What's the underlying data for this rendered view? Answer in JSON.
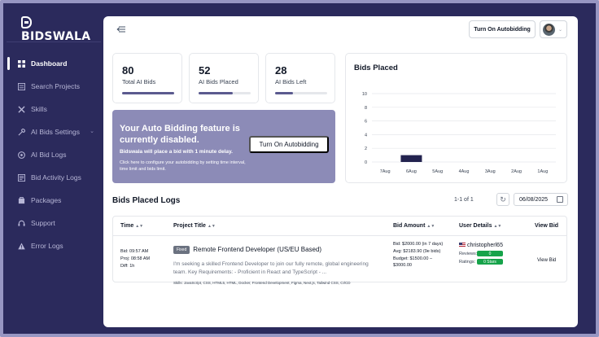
{
  "brand": {
    "name": "BIDSWALA"
  },
  "sidebar": {
    "items": [
      {
        "label": "Dashboard",
        "icon": "dashboard-icon"
      },
      {
        "label": "Search Projects",
        "icon": "search-projects-icon"
      },
      {
        "label": "Skills",
        "icon": "skills-icon"
      },
      {
        "label": "AI Bids Settings",
        "icon": "settings-icon"
      },
      {
        "label": "AI Bid Logs",
        "icon": "bid-logs-icon"
      },
      {
        "label": "Bid Activity Logs",
        "icon": "activity-logs-icon"
      },
      {
        "label": "Packages",
        "icon": "packages-icon"
      },
      {
        "label": "Support",
        "icon": "support-icon"
      },
      {
        "label": "Error Logs",
        "icon": "error-logs-icon"
      }
    ]
  },
  "header": {
    "autobid_button": "Turn On Autobidding"
  },
  "stats": [
    {
      "value": "80",
      "label": "Total AI Bids",
      "progress": 1.0
    },
    {
      "value": "52",
      "label": "AI Bids Placed",
      "progress": 0.65
    },
    {
      "value": "28",
      "label": "AI Bids Left",
      "progress": 0.35
    }
  ],
  "promo": {
    "title": "Your Auto Bidding feature is currently disabled.",
    "subtitle": "Bidswala will place a bid with 1 minute delay.",
    "help": "Click here to configure your autobidding by setting time interval, time limit and bids limit.",
    "button": "Turn On Autobidding"
  },
  "chart_data": {
    "type": "bar",
    "title": "Bids Placed",
    "categories": [
      "7Aug",
      "6Aug",
      "5Aug",
      "4Aug",
      "3Aug",
      "2Aug",
      "1Aug"
    ],
    "values": [
      0,
      1,
      0,
      0,
      0,
      0,
      0
    ],
    "ylim": [
      0,
      10
    ],
    "yticks": [
      0,
      2,
      4,
      6,
      8,
      10
    ],
    "grid": true,
    "colors": {
      "bar": "#23234f",
      "grid": "#e5e7eb"
    }
  },
  "logs": {
    "title": "Bids Placed Logs",
    "pagination": "1-1 of 1",
    "date": "06/08/2025",
    "columns": [
      "Time",
      "Project Title",
      "Bid Amount",
      "User Details",
      "View Bid"
    ],
    "rows": [
      {
        "time": [
          "Bid: 09:57 AM",
          "Proj: 08:58 AM",
          "Diff: 1h"
        ],
        "badge": "Fixed",
        "title": "Remote Frontend Developer (US/EU Based)",
        "description": "I'm seeking a skilled Frontend Developer to join our fully remote, global engineering team. Key Requirements: - Proficient in React and TypeScript - ...",
        "skills": "Skills: JavaScript, CSS, HTML5, HTML, Docker, Frontend Development, Figma, Next.js, Tailwind CSS, CI/CD",
        "bid_amount": [
          "Bid: $2000.00 (in 7 days)",
          "Avg: $2183.90 (9e bids)",
          "Budget: $1500.00 – $3000.00"
        ],
        "user": "christopherl65",
        "reviews_label": "Reviews:",
        "reviews": "0",
        "ratings_label": "Ratings:",
        "ratings": "0 Stars",
        "view": "View Bid"
      }
    ]
  }
}
